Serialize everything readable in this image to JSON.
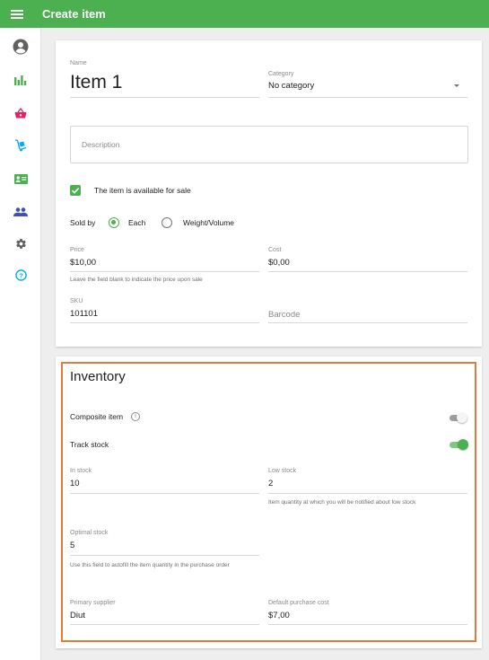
{
  "header": {
    "title": "Create item"
  },
  "sidebar": {
    "items": [
      {
        "name": "account-icon"
      },
      {
        "name": "reports-icon"
      },
      {
        "name": "items-icon"
      },
      {
        "name": "inventory-icon"
      },
      {
        "name": "employees-icon"
      },
      {
        "name": "customers-icon"
      },
      {
        "name": "settings-icon"
      },
      {
        "name": "help-icon"
      }
    ]
  },
  "item": {
    "name_label": "Name",
    "name_value": "Item 1",
    "category_label": "Category",
    "category_value": "No category",
    "description_placeholder": "Description",
    "available_label": "The item is available for sale",
    "sold_by_label": "Sold by",
    "sold_by_options": [
      "Each",
      "Weight/Volume"
    ],
    "sold_by_selected": "Each",
    "price_label": "Price",
    "price_value": "$10,00",
    "price_hint": "Leave the field blank to indicate the price upon sale",
    "cost_label": "Cost",
    "cost_value": "$0,00",
    "sku_label": "SKU",
    "sku_value": "101101",
    "barcode_placeholder": "Barcode"
  },
  "inventory": {
    "title": "Inventory",
    "composite_label": "Composite item",
    "composite_on": false,
    "track_label": "Track stock",
    "track_on": true,
    "in_stock_label": "In stock",
    "in_stock_value": "10",
    "low_stock_label": "Low stock",
    "low_stock_value": "2",
    "low_stock_hint": "Item quantity at which you will be notified about low stock",
    "optimal_label": "Optimal stock",
    "optimal_value": "5",
    "optimal_hint": "Use this field to autofill the item quantity in the purchase order",
    "supplier_label": "Primary supplier",
    "supplier_value": "Diut",
    "purchase_cost_label": "Default purchase cost",
    "purchase_cost_value": "$7,00"
  },
  "colors": {
    "accent": "#4caf50",
    "highlight": "#e07b39",
    "basket": "#e91e63",
    "reports": "#4caf50",
    "inventory_icon": "#03a9f4",
    "sidebar_icon": "#616161"
  }
}
